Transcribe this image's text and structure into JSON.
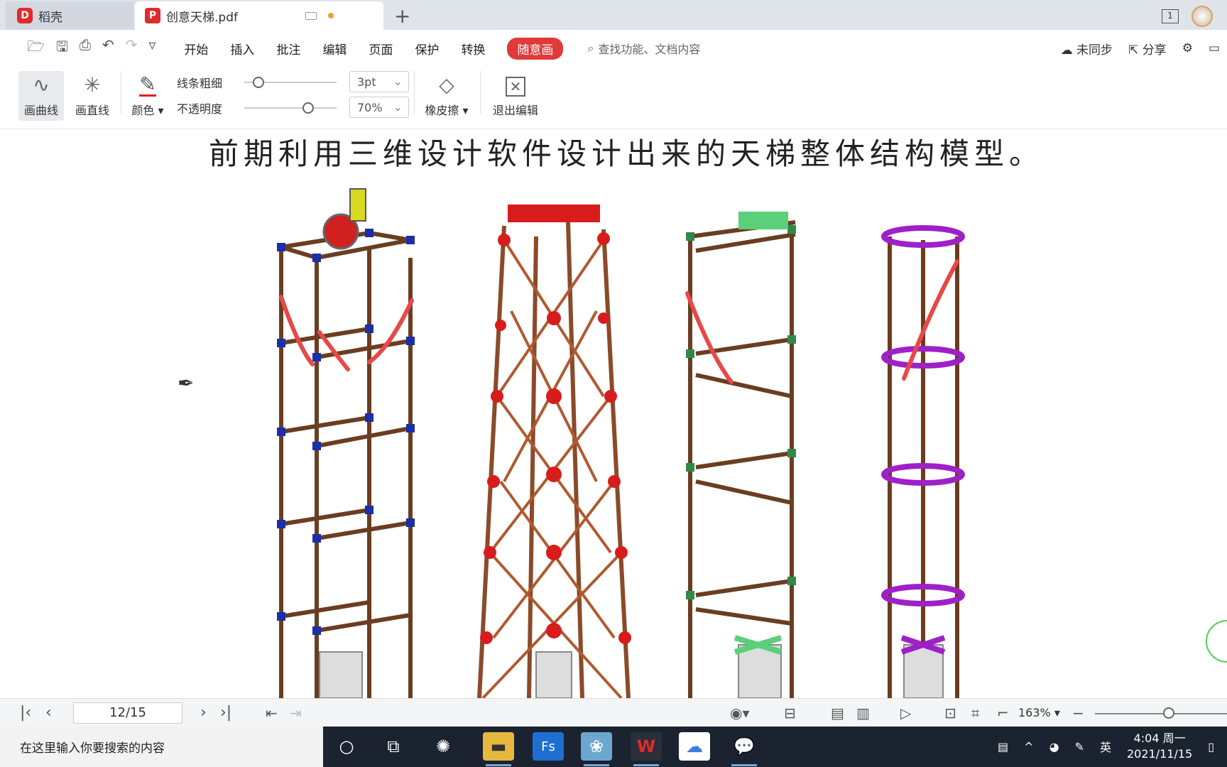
{
  "tabs": [
    {
      "label": "稻壳",
      "icon": "daoke-logo-icon"
    },
    {
      "label": "创意天梯.pdf",
      "icon": "pdf-icon"
    }
  ],
  "menubar": {
    "items": [
      "开始",
      "插入",
      "批注",
      "编辑",
      "页面",
      "保护",
      "转换"
    ],
    "active": "随意画",
    "search_placeholder": "查找功能、文档内容",
    "sync": "未同步",
    "share": "分享"
  },
  "ribbon": {
    "draw_curve": "画曲线",
    "draw_line": "画直线",
    "color": "颜色",
    "line_width_label": "线条粗细",
    "line_width_value": "3pt",
    "opacity_label": "不透明度",
    "opacity_value": "70%",
    "eraser": "橡皮擦",
    "exit": "退出编辑",
    "pen_color": "#e02020"
  },
  "document": {
    "caption": "前期利用三维设计软件设计出来的天梯整体结构模型。"
  },
  "statusbar": {
    "page": "12/15",
    "zoom": "163%"
  },
  "taskbar": {
    "search_placeholder": "在这里输入你要搜索的内容",
    "lang": "英",
    "time": "4:04 周一",
    "date": "2021/11/15"
  }
}
